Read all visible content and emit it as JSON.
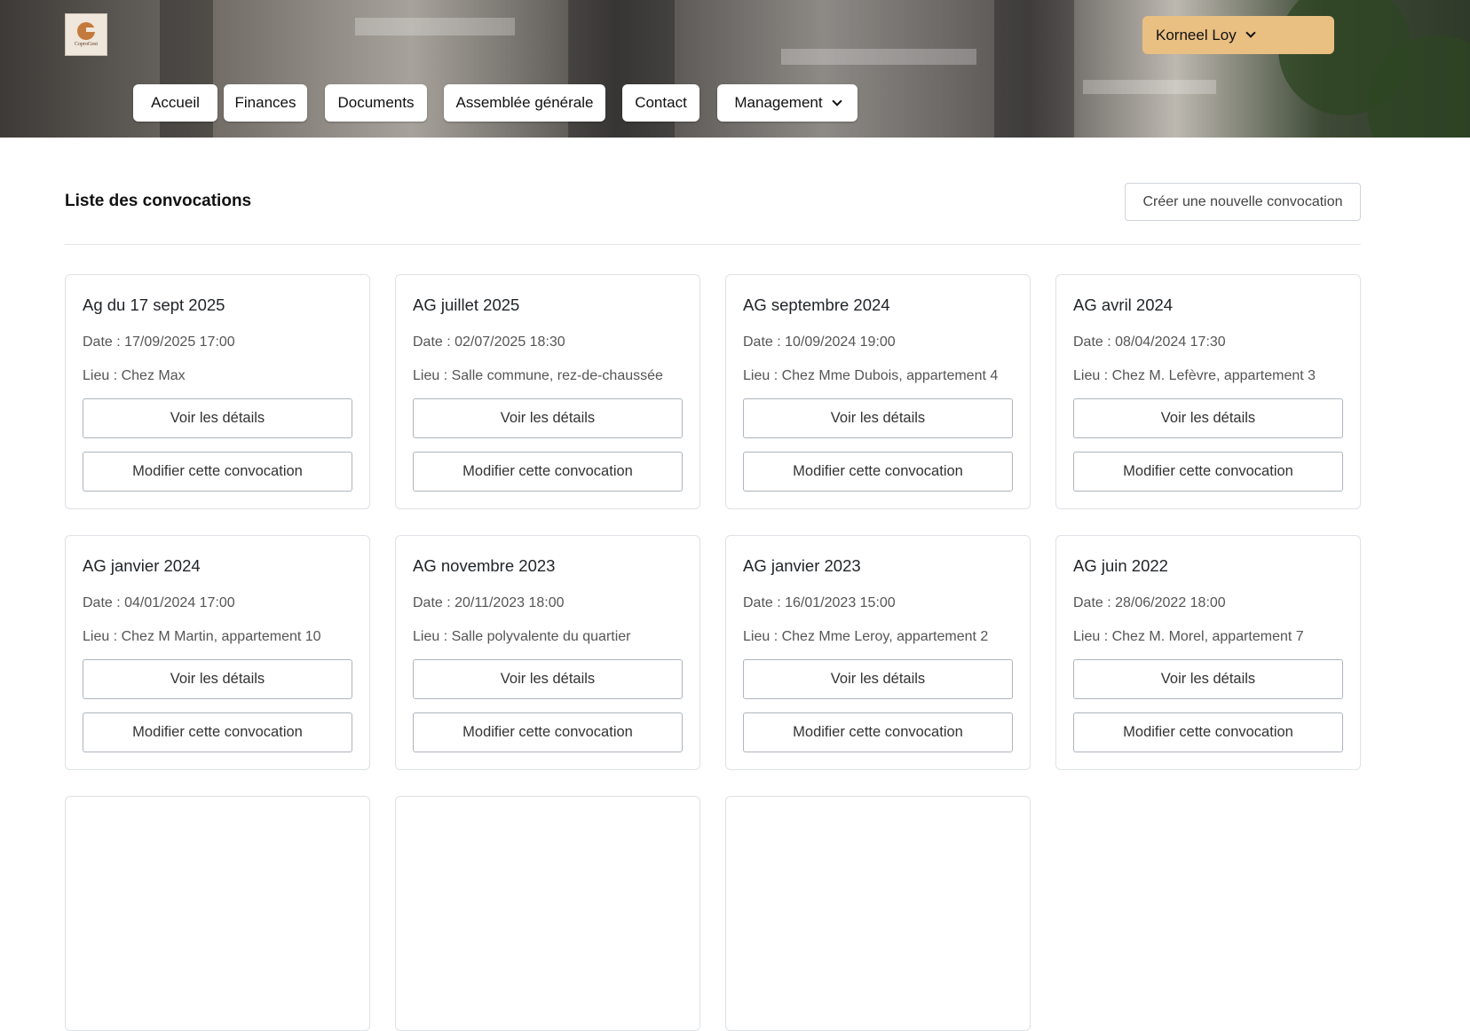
{
  "header": {
    "logo_alt": "CoproGest",
    "nav": [
      {
        "label": "Accueil"
      },
      {
        "label": "Finances"
      },
      {
        "label": "Documents"
      },
      {
        "label": "Assemblée générale"
      },
      {
        "label": "Contact"
      },
      {
        "label": "Management",
        "has_dropdown": true
      }
    ],
    "user": {
      "name": "Korneel Loy",
      "has_dropdown": true
    },
    "accent_color": "#e9bf82"
  },
  "main": {
    "title": "Liste des convocations",
    "create_button": "Créer une nouvelle convocation",
    "convocations": [
      {
        "title": "Ag du 17 sept 2025",
        "date": "Date : 17/09/2025 17:00",
        "lieu": "Lieu : Chez Max",
        "details_label": "Voir les détails",
        "edit_label": "Modifier cette convocation"
      },
      {
        "title": "AG juillet 2025",
        "date": "Date : 02/07/2025 18:30",
        "lieu": "Lieu : Salle commune, rez-de-chaussée",
        "details_label": "Voir les détails",
        "edit_label": "Modifier cette convocation"
      },
      {
        "title": "AG septembre 2024",
        "date": "Date : 10/09/2024 19:00",
        "lieu": "Lieu : Chez Mme Dubois, appartement 4",
        "details_label": "Voir les détails",
        "edit_label": "Modifier cette convocation"
      },
      {
        "title": "AG avril 2024",
        "date": "Date : 08/04/2024 17:30",
        "lieu": "Lieu : Chez M. Lefèvre, appartement 3",
        "details_label": "Voir les détails",
        "edit_label": "Modifier cette convocation"
      },
      {
        "title": "AG janvier 2024",
        "date": "Date : 04/01/2024 17:00",
        "lieu": "Lieu : Chez M Martin, appartement 10",
        "details_label": "Voir les détails",
        "edit_label": "Modifier cette convocation"
      },
      {
        "title": "AG novembre 2023",
        "date": "Date : 20/11/2023 18:00",
        "lieu": "Lieu : Salle polyvalente du quartier",
        "details_label": "Voir les détails",
        "edit_label": "Modifier cette convocation"
      },
      {
        "title": "AG janvier 2023",
        "date": "Date : 16/01/2023 15:00",
        "lieu": "Lieu : Chez Mme Leroy, appartement 2",
        "details_label": "Voir les détails",
        "edit_label": "Modifier cette convocation"
      },
      {
        "title": "AG juin 2022",
        "date": "Date : 28/06/2022 18:00",
        "lieu": "Lieu : Chez M. Morel, appartement 7",
        "details_label": "Voir les détails",
        "edit_label": "Modifier cette convocation"
      }
    ]
  }
}
